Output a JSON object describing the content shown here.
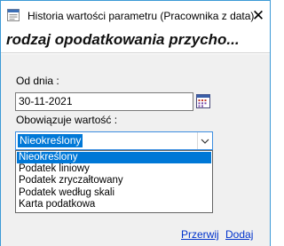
{
  "window": {
    "title": "Historia wartości parametru (Pracownika z data)",
    "close_glyph": "✕"
  },
  "banner": {
    "heading": "rodzaj opodatkowania przycho..."
  },
  "form": {
    "date_label": "Od dnia :",
    "date_value": "30-11-2021",
    "value_label": "Obowiązuje wartość  :",
    "combo_selected": "Nieokreślony",
    "options": [
      "Nieokreślony",
      "Podatek liniowy",
      "Podatek zryczałtowany",
      "Podatek według skali",
      "Karta podatkowa"
    ],
    "selected_index": 0
  },
  "actions": {
    "cancel_label": "Przerwij",
    "add_label": "Dodaj"
  },
  "colors": {
    "accent": "#0078d7",
    "link": "#0033cc",
    "window_border": "#3c9ad6"
  },
  "icons": [
    "app-icon",
    "close-icon",
    "calendar-icon",
    "chevron-down-icon"
  ]
}
